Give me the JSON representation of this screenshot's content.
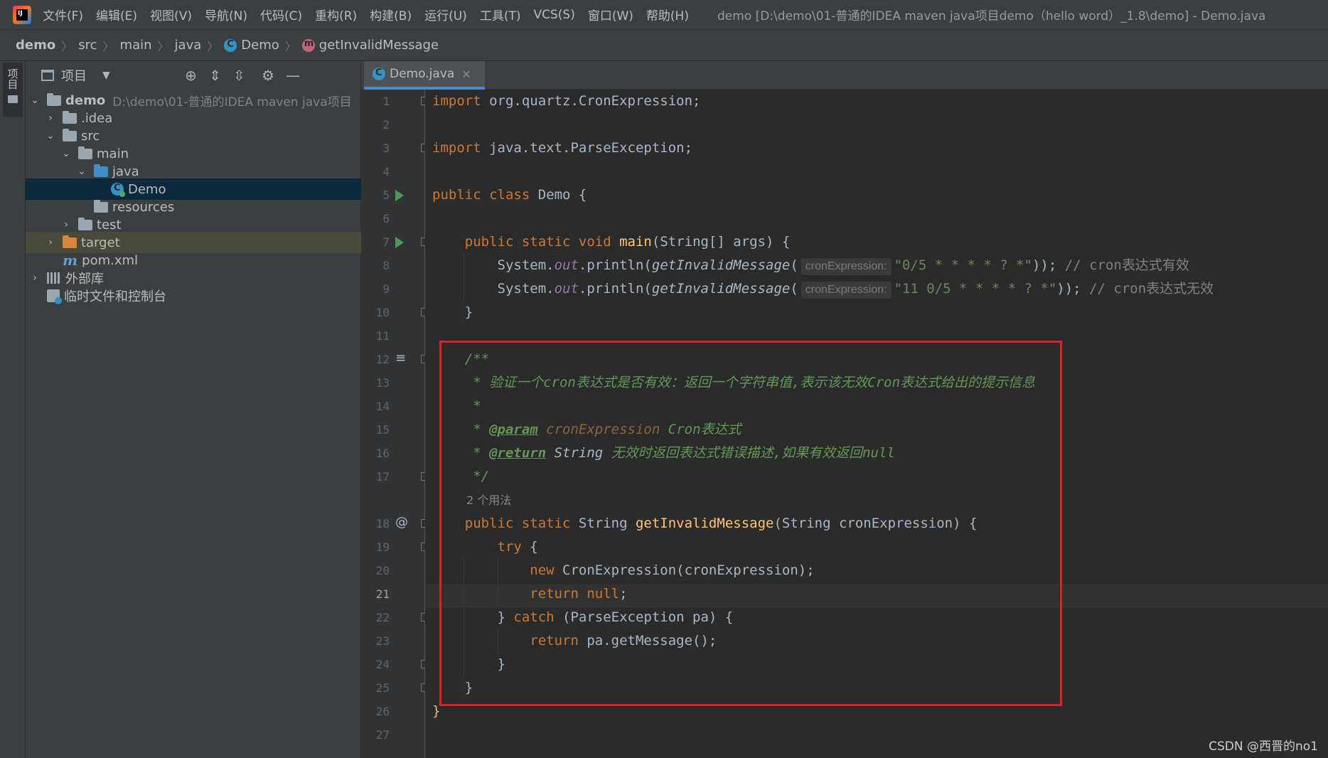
{
  "menubar": {
    "items": [
      "文件(F)",
      "编辑(E)",
      "视图(V)",
      "导航(N)",
      "代码(C)",
      "重构(R)",
      "构建(B)",
      "运行(U)",
      "工具(T)",
      "VCS(S)",
      "窗口(W)",
      "帮助(H)"
    ],
    "title": "demo [D:\\demo\\01-普通的IDEA maven java项目demo（hello word）_1.8\\demo] - Demo.java"
  },
  "breadcrumb": {
    "project": "demo",
    "src": "src",
    "main": "main",
    "java": "java",
    "class": "Demo",
    "method": "getInvalidMessage"
  },
  "left_strip": {
    "tab_label": "项目"
  },
  "project_panel": {
    "title": "项目",
    "tree": {
      "root": {
        "name": "demo",
        "path": "D:\\demo\\01-普通的IDEA maven java项目"
      },
      "idea": ".idea",
      "src": "src",
      "main": "main",
      "java": "java",
      "demo_class": "Demo",
      "resources": "resources",
      "test": "test",
      "target": "target",
      "pom": "pom.xml",
      "external_libs": "外部库",
      "scratches": "临时文件和控制台"
    }
  },
  "editor": {
    "tab_label": "Demo.java",
    "current_line": 21,
    "line_numbers": [
      "1",
      "2",
      "3",
      "4",
      "5",
      "6",
      "7",
      "8",
      "9",
      "10",
      "11",
      "12",
      "13",
      "14",
      "15",
      "16",
      "17",
      "18",
      "19",
      "20",
      "21",
      "22",
      "23",
      "24",
      "25",
      "26",
      "27"
    ],
    "usage_hint": "2 个用法",
    "param_hint": "cronExpression:",
    "code": {
      "l1_kw": "import",
      "l1_rest": " org.quartz.CronExpression;",
      "l3_kw": "import",
      "l3_rest": " java.text.ParseException;",
      "l5_kw": "public class",
      "l5_rest": " Demo {",
      "l7_kw": "    public static void",
      "l7_fn": " main",
      "l7_rest": "(String[] args) {",
      "l8_a": "        System.",
      "l8_field": "out",
      "l8_b": ".println(",
      "l8_call": "getInvalidMessage",
      "l8_c": "(",
      "l8_str": "\"0/5 * * * * ? *\"",
      "l8_d": "));",
      "l8_cmt": " // cron表达式有效",
      "l9_a": "        System.",
      "l9_field": "out",
      "l9_b": ".println(",
      "l9_call": "getInvalidMessage",
      "l9_c": "(",
      "l9_str": "\"11 0/5 * * * * ? *\"",
      "l9_d": "));",
      "l9_cmt": " // cron表达式无效",
      "l10": "    }",
      "l12": "    /**",
      "l13": "     * 验证一个cron表达式是否有效：返回一个字符串值,表示该无效Cron表达式给出的提示信息",
      "l14": "     *",
      "l15_a": "     * ",
      "l15_tag": "@param",
      "l15_val": " cronExpression",
      "l15_b": " Cron表达式",
      "l16_a": "     * ",
      "l16_tag": "@return",
      "l16_val": " String",
      "l16_b": " 无效时返回表达式错误描述,如果有效返回null",
      "l17": "     */",
      "l18_kw": "    public static",
      "l18_a": " String ",
      "l18_fn": "getInvalidMessage",
      "l18_b": "(String cronExpression) {",
      "l19_kw": "        try",
      "l19_b": " {",
      "l20_kw": "            new",
      "l20_b": " CronExpression(cronExpression);",
      "l21_kw": "            return null",
      "l21_b": ";",
      "l22_a": "        } ",
      "l22_kw": "catch",
      "l22_b": " (ParseException pa) {",
      "l23_kw": "            return",
      "l23_b": " pa.getMessage();",
      "l24": "        }",
      "l25": "    }",
      "l26": "}"
    }
  },
  "watermark": "CSDN @西晋的no1",
  "colors": {
    "highlight_box": "#e02020",
    "keyword": "#cc7832",
    "string": "#6a8759",
    "function": "#ffc66d",
    "doc_comment": "#629755",
    "selected_row": "#0d293e"
  },
  "icons": [
    "intellij-logo-icon",
    "class-icon",
    "method-icon",
    "folder-icon",
    "maven-icon",
    "library-icon",
    "scratch-icon",
    "run-icon",
    "gear-icon",
    "collapse-icon",
    "locate-icon",
    "expand-icon",
    "minimize-icon",
    "close-icon",
    "chevron-down-icon",
    "at-icon",
    "doc-lines-icon"
  ]
}
